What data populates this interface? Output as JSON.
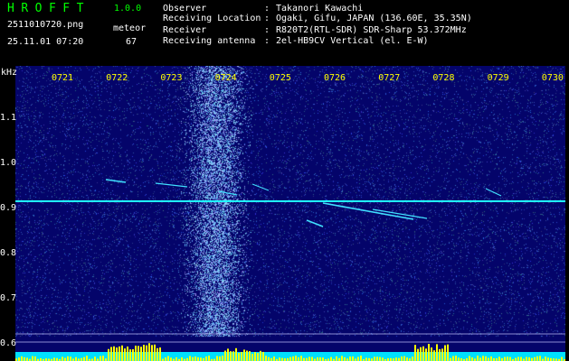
{
  "header": {
    "app_title": "HROFFT",
    "app_version": "1.0.0",
    "file_name": "2511010720.png",
    "meteor_label": "meteor",
    "date_time": "25.11.01 07:20",
    "meteor_count": "67",
    "info": [
      {
        "key": "Observer",
        "sep": ":",
        "value": "Takanori Kawachi"
      },
      {
        "key": "Receiving Location",
        "sep": ":",
        "value": "Ogaki, Gifu, JAPAN (136.60E, 35.35N)"
      },
      {
        "key": "Receiver",
        "sep": ":",
        "value": "R820T2(RTL-SDR) SDR-Sharp 53.372MHz"
      },
      {
        "key": "Receiving antenna",
        "sep": ":",
        "value": "2el-HB9CV Vertical (el. E-W)"
      }
    ]
  },
  "spectrogram": {
    "y_unit": "kHz",
    "y_ticks": [
      "1.1",
      "1.0",
      "0.9",
      "0.8",
      "0.7",
      "0.6"
    ],
    "y_tick_values": [
      1.1,
      1.0,
      0.9,
      0.8,
      0.7,
      0.6
    ],
    "x_ticks": [
      "0721",
      "0722",
      "0723",
      "0724",
      "0725",
      "0726",
      "0727",
      "0728",
      "0729",
      "0730"
    ],
    "carrier_khz": 0.915
  },
  "colors": {
    "title": "#00ff00",
    "header_text": "#ffffff",
    "axis_text": "#ffff00",
    "background": "#000000",
    "noise": "#04046a",
    "carrier": "#20ffff",
    "baseline_cyan": "#00e0ff",
    "baseline_yellow": "#ffff00",
    "meteor": "#40e0ff"
  }
}
